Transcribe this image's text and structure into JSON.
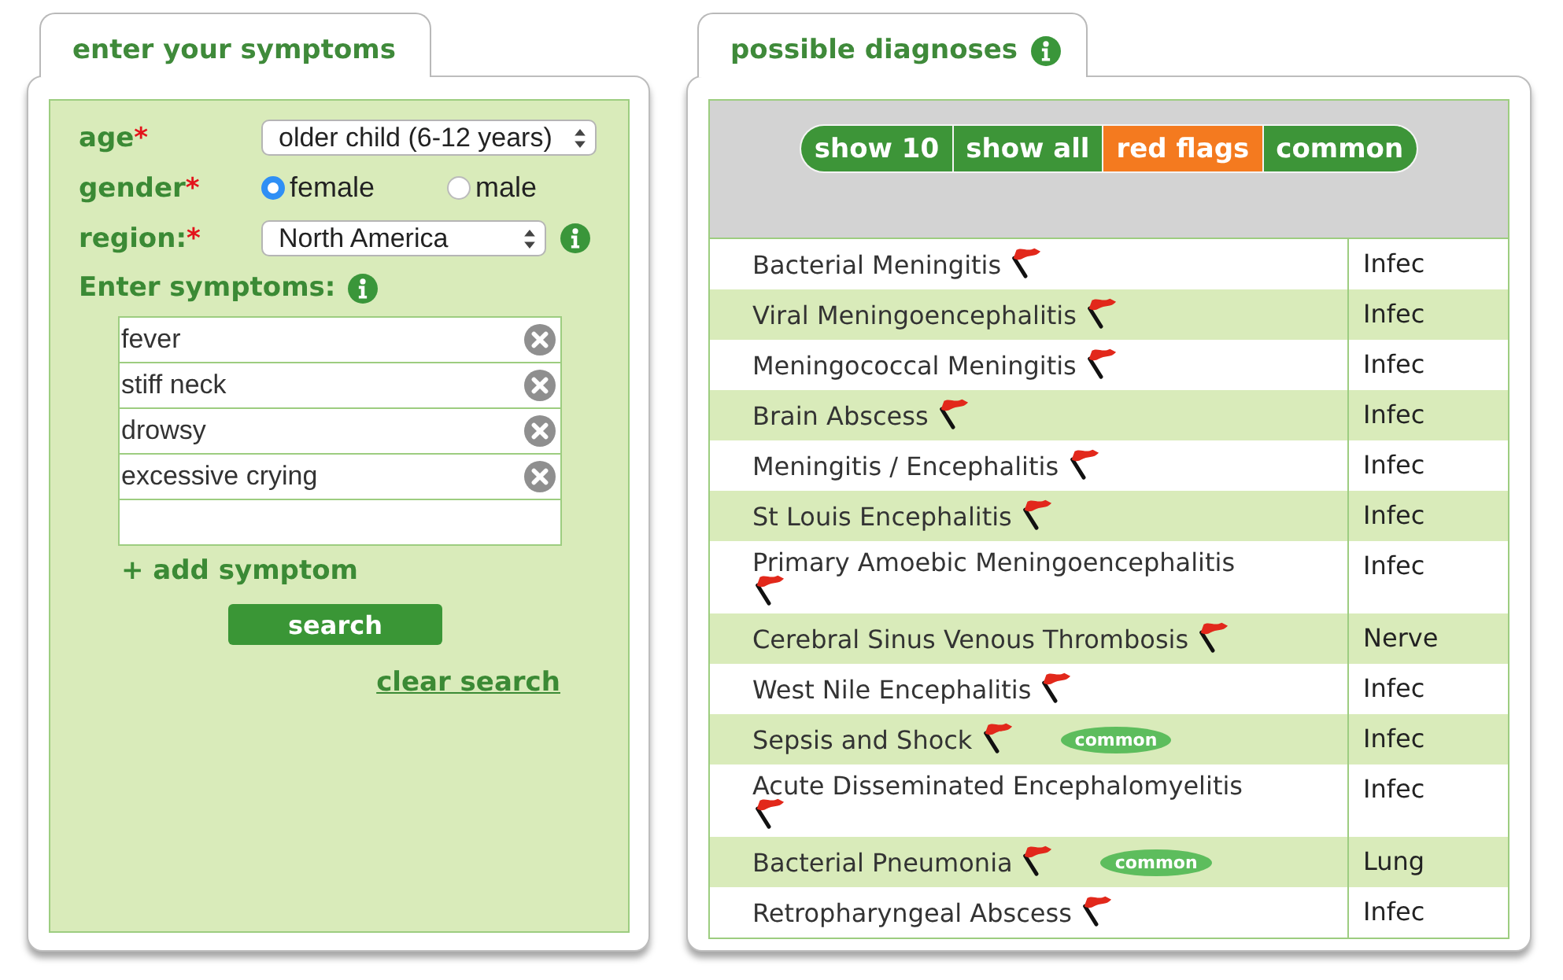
{
  "symptom_panel": {
    "tab": {
      "title": "enter your symptoms"
    },
    "fields": [
      {
        "kind": "select",
        "label": "age",
        "required_mark": "*",
        "value": "older child (6-12 years)"
      },
      {
        "kind": "radio",
        "label": "gender",
        "required_mark": "*",
        "options": [
          {
            "label": "female",
            "selected": true
          },
          {
            "label": "male",
            "selected": false
          }
        ]
      },
      {
        "kind": "select",
        "label": "region:",
        "required_mark": "*",
        "value": "North America",
        "info": true
      }
    ],
    "symptoms_heading": {
      "label": "Enter symptoms:",
      "info": true
    },
    "symptoms": [
      "fever",
      "stiff neck",
      "drowsy",
      "excessive crying"
    ],
    "add_link": "+ add symptom",
    "search_button": "search",
    "clear_link": "clear search"
  },
  "diagnoses_panel": {
    "tab": {
      "title": "possible diagnoses",
      "info": true
    },
    "filters": [
      {
        "label": "show 10",
        "selected": false
      },
      {
        "label": "show all",
        "selected": false
      },
      {
        "label": "red flags",
        "selected": true
      },
      {
        "label": "common",
        "selected": false
      }
    ],
    "rows": [
      {
        "name": "Bacterial Meningitis",
        "red_flag": true,
        "category": "Infec"
      },
      {
        "name": "Viral Meningoencephalitis",
        "red_flag": true,
        "category": "Infec"
      },
      {
        "name": "Meningococcal Meningitis",
        "red_flag": true,
        "category": "Infec"
      },
      {
        "name": "Brain Abscess",
        "red_flag": true,
        "category": "Infec"
      },
      {
        "name": "Meningitis / Encephalitis",
        "red_flag": true,
        "category": "Infec"
      },
      {
        "name": "St Louis Encephalitis",
        "red_flag": true,
        "category": "Infec"
      },
      {
        "name": "Primary Amoebic Meningoencephalitis",
        "red_flag": true,
        "category": "Infec"
      },
      {
        "name": "Cerebral Sinus Venous Thrombosis",
        "red_flag": true,
        "category": "Nerve"
      },
      {
        "name": "West Nile Encephalitis",
        "red_flag": true,
        "category": "Infec"
      },
      {
        "name": "Sepsis and Shock",
        "red_flag": true,
        "badge": "common",
        "category": "Infec"
      },
      {
        "name": "Acute Disseminated Encephalomyelitis",
        "red_flag": true,
        "category": "Infec"
      },
      {
        "name": "Bacterial Pneumonia",
        "red_flag": true,
        "badge": "common",
        "category": "Lung"
      },
      {
        "name": "Retropharyngeal Abscess",
        "red_flag": true,
        "category": "Infec"
      }
    ]
  }
}
